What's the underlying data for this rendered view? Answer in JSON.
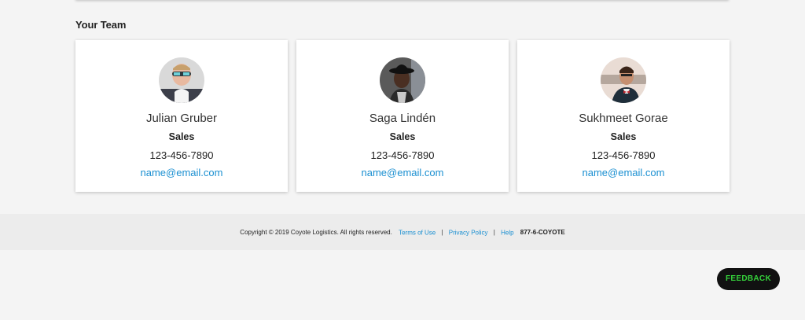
{
  "team_section": {
    "title": "Your Team",
    "members": [
      {
        "name": "Julian Gruber",
        "role": "Sales",
        "phone": "123-456-7890",
        "email": "name@email.com"
      },
      {
        "name": "Saga Lindén",
        "role": "Sales",
        "phone": "123-456-7890",
        "email": "name@email.com"
      },
      {
        "name": "Sukhmeet Gorae",
        "role": "Sales",
        "phone": "123-456-7890",
        "email": "name@email.com"
      }
    ]
  },
  "footer": {
    "copyright": "Copyright © 2019 Coyote Logistics. All rights reserved.",
    "links": {
      "terms": "Terms of Use",
      "privacy": "Privacy Policy",
      "help": "Help"
    },
    "separator": "|",
    "phone": "877-6-COYOTE"
  },
  "feedback": {
    "label": "FEEDBACK"
  },
  "colors": {
    "link": "#1a8fd1",
    "feedback_text": "#35d23b",
    "feedback_bg": "#111111",
    "background": "#f4f4f4",
    "footer_bg": "#ececec"
  }
}
